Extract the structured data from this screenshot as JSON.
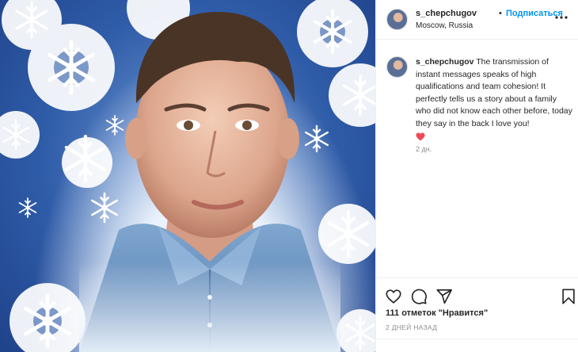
{
  "post": {
    "username": "s_chepchugov",
    "separator": "•",
    "follow_label": "Подписаться",
    "location": "Moscow, Russia"
  },
  "caption": {
    "username": "s_chepchugov",
    "text": "The transmission of instant messages speaks of high qualifications and team cohesion! It perfectly tells us a story about a family who did not know each other before, today they say in the back I love you!",
    "emoji": "heart-emoji",
    "time": "2 дн."
  },
  "actions": {
    "likes": "111 отметок \"Нравится\"",
    "ago": "2 ДНЕЙ НАЗАД"
  },
  "icons": [
    "more-icon",
    "like-icon",
    "comment-icon",
    "share-icon",
    "save-icon"
  ],
  "colors": {
    "accent": "#0095f6",
    "text": "#262626",
    "muted": "#8e8e8e",
    "heart": "#ed4956"
  }
}
